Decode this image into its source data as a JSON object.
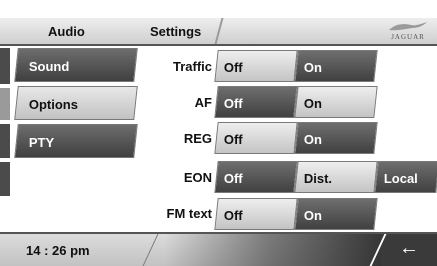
{
  "header": {
    "section_title": "Audio",
    "page_title": "Settings",
    "logo_text": "JAGUAR"
  },
  "menu": {
    "items": [
      {
        "label": "Sound",
        "state": "selected"
      },
      {
        "label": "Options",
        "state": "normal"
      },
      {
        "label": "PTY",
        "state": "selected"
      }
    ]
  },
  "settings": {
    "rows": [
      {
        "label": "Traffic",
        "options": [
          {
            "label": "Off",
            "selected": true
          },
          {
            "label": "On",
            "selected": false
          }
        ]
      },
      {
        "label": "AF",
        "options": [
          {
            "label": "Off",
            "selected": false
          },
          {
            "label": "On",
            "selected": true
          }
        ]
      },
      {
        "label": "REG",
        "options": [
          {
            "label": "Off",
            "selected": true
          },
          {
            "label": "On",
            "selected": false
          }
        ]
      },
      {
        "label": "EON",
        "options": [
          {
            "label": "Off",
            "selected": false
          },
          {
            "label": "Dist.",
            "selected": true
          },
          {
            "label": "Local",
            "selected": false
          }
        ]
      },
      {
        "label": "FM text",
        "options": [
          {
            "label": "Off",
            "selected": true
          },
          {
            "label": "On",
            "selected": false
          }
        ]
      }
    ]
  },
  "footer": {
    "clock": "14 : 26 pm",
    "back_icon": "back-arrow-icon"
  },
  "colors": {
    "selected_light": "#d8d8d8",
    "unselected_dark": "#4a4a4a",
    "divider": "#555555"
  }
}
